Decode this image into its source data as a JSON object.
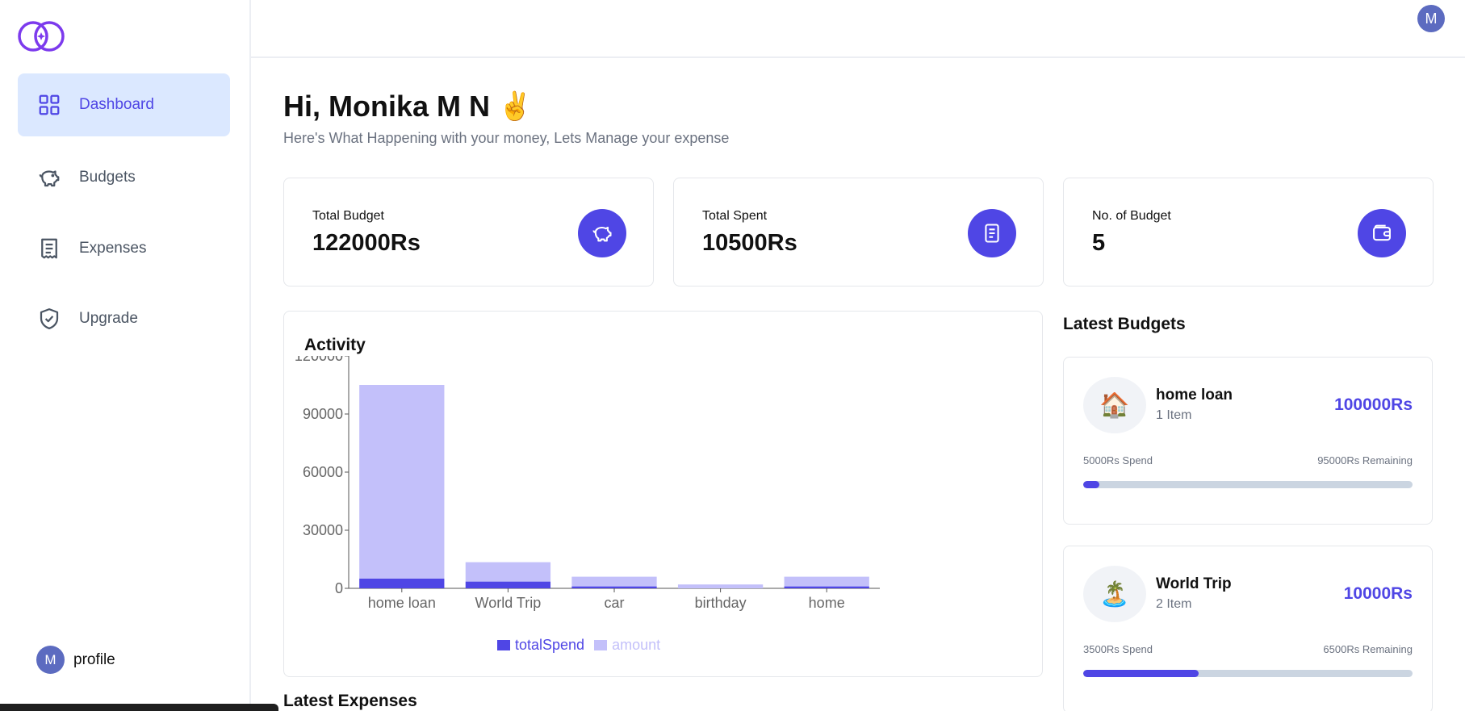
{
  "sidebar": {
    "items": [
      {
        "label": "Dashboard"
      },
      {
        "label": "Budgets"
      },
      {
        "label": "Expenses"
      },
      {
        "label": "Upgrade"
      }
    ],
    "profile": {
      "initial": "M",
      "label": "profile"
    }
  },
  "header": {
    "avatar_initial": "M"
  },
  "greeting": {
    "title": "Hi, Monika M N",
    "emoji": "✌️",
    "subtitle": "Here's What Happening with your money, Lets Manage your expense"
  },
  "stats": [
    {
      "label": "Total Budget",
      "value": "122000Rs",
      "icon": "piggy-bank-icon"
    },
    {
      "label": "Total Spent",
      "value": "10500Rs",
      "icon": "receipt-icon"
    },
    {
      "label": "No. of Budget",
      "value": "5",
      "icon": "wallet-icon"
    }
  ],
  "activity": {
    "title": "Activity"
  },
  "chart_data": {
    "type": "bar",
    "stacked": true,
    "categories": [
      "home loan",
      "World Trip",
      "car",
      "birthday",
      "home"
    ],
    "series": [
      {
        "name": "totalSpend",
        "values": [
          5000,
          3500,
          1000,
          0,
          1000
        ],
        "color": "#4f46e5"
      },
      {
        "name": "amount",
        "values": [
          100000,
          10000,
          5000,
          2000,
          5000
        ],
        "color": "#c3c0fa"
      }
    ],
    "y_ticks": [
      "0",
      "30000",
      "60000",
      "90000",
      "120000"
    ],
    "ylim": [
      0,
      120000
    ],
    "legend_position": "bottom"
  },
  "latest_expenses": {
    "title": "Latest Expenses"
  },
  "latest_budgets": {
    "title": "Latest Budgets",
    "items": [
      {
        "emoji": "🏠",
        "name": "home loan",
        "items": "1 Item",
        "amount": "100000Rs",
        "spend": "5000Rs Spend",
        "remaining": "95000Rs Remaining",
        "progress": 0.05
      },
      {
        "emoji": "🏝️",
        "name": "World Trip",
        "items": "2 Item",
        "amount": "10000Rs",
        "spend": "3500Rs Spend",
        "remaining": "6500Rs Remaining",
        "progress": 0.35
      }
    ]
  },
  "colors": {
    "accent": "#4f46e5",
    "accent_light": "#c3c0fa",
    "active_bg": "#dbe8ff"
  }
}
